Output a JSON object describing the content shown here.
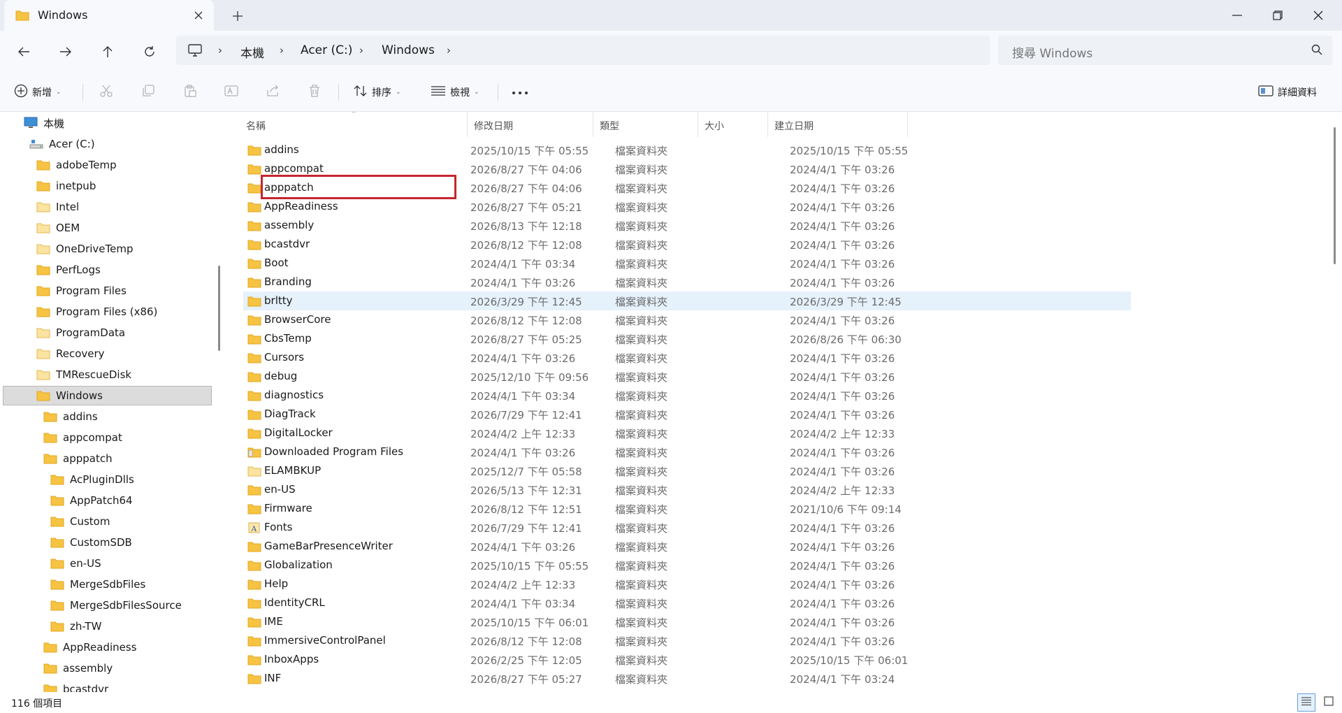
{
  "tab": {
    "title": "Windows"
  },
  "address": {
    "breadcrumbs": [
      "本機",
      "Acer (C:)",
      "Windows"
    ]
  },
  "search": {
    "placeholder": "搜尋 Windows"
  },
  "commands": {
    "new_label": "新增",
    "sort_label": "排序",
    "view_label": "檢視",
    "details_label": "詳細資料"
  },
  "columns": {
    "name": "名稱",
    "modified": "修改日期",
    "type": "類型",
    "size": "大小",
    "created": "建立日期"
  },
  "tree": [
    {
      "label": "本機",
      "level": 0,
      "icon": "computer-icon"
    },
    {
      "label": "Acer (C:)",
      "level": 1,
      "icon": "drive-icon"
    },
    {
      "label": "adobeTemp",
      "level": 2,
      "icon": "folder-icon"
    },
    {
      "label": "inetpub",
      "level": 2,
      "icon": "folder-icon"
    },
    {
      "label": "Intel",
      "level": 2,
      "icon": "folder-open-icon"
    },
    {
      "label": "OEM",
      "level": 2,
      "icon": "folder-open-icon"
    },
    {
      "label": "OneDriveTemp",
      "level": 2,
      "icon": "folder-open-icon"
    },
    {
      "label": "PerfLogs",
      "level": 2,
      "icon": "folder-icon"
    },
    {
      "label": "Program Files",
      "level": 2,
      "icon": "folder-icon"
    },
    {
      "label": "Program Files (x86)",
      "level": 2,
      "icon": "folder-icon"
    },
    {
      "label": "ProgramData",
      "level": 2,
      "icon": "folder-open-icon"
    },
    {
      "label": "Recovery",
      "level": 2,
      "icon": "folder-open-icon"
    },
    {
      "label": "TMRescueDisk",
      "level": 2,
      "icon": "folder-open-icon"
    },
    {
      "label": "Windows",
      "level": 2,
      "icon": "folder-icon",
      "selected": true
    },
    {
      "label": "addins",
      "level": 3,
      "icon": "folder-icon"
    },
    {
      "label": "appcompat",
      "level": 3,
      "icon": "folder-icon"
    },
    {
      "label": "apppatch",
      "level": 3,
      "icon": "folder-icon"
    },
    {
      "label": "AcPluginDlls",
      "level": 4,
      "icon": "folder-icon"
    },
    {
      "label": "AppPatch64",
      "level": 4,
      "icon": "folder-icon"
    },
    {
      "label": "Custom",
      "level": 4,
      "icon": "folder-icon"
    },
    {
      "label": "CustomSDB",
      "level": 4,
      "icon": "folder-icon"
    },
    {
      "label": "en-US",
      "level": 4,
      "icon": "folder-icon"
    },
    {
      "label": "MergeSdbFiles",
      "level": 4,
      "icon": "folder-icon"
    },
    {
      "label": "MergeSdbFilesSource",
      "level": 4,
      "icon": "folder-icon"
    },
    {
      "label": "zh-TW",
      "level": 4,
      "icon": "folder-icon"
    },
    {
      "label": "AppReadiness",
      "level": 3,
      "icon": "folder-icon"
    },
    {
      "label": "assembly",
      "level": 3,
      "icon": "folder-icon"
    },
    {
      "label": "bcastdvr",
      "level": 3,
      "icon": "folder-icon"
    }
  ],
  "files": [
    {
      "name": "addins",
      "modified": "2025/10/15 下午 05:55",
      "type": "檔案資料夾",
      "created": "2025/10/15 下午 05:55",
      "icon": "folder-icon"
    },
    {
      "name": "appcompat",
      "modified": "2026/8/27 下午 04:06",
      "type": "檔案資料夾",
      "created": "2024/4/1 下午 03:26",
      "icon": "folder-icon"
    },
    {
      "name": "apppatch",
      "modified": "2026/8/27 下午 04:06",
      "type": "檔案資料夾",
      "created": "2024/4/1 下午 03:26",
      "icon": "folder-icon"
    },
    {
      "name": "AppReadiness",
      "modified": "2026/8/27 下午 05:21",
      "type": "檔案資料夾",
      "created": "2024/4/1 下午 03:26",
      "icon": "folder-icon"
    },
    {
      "name": "assembly",
      "modified": "2026/8/13 下午 12:18",
      "type": "檔案資料夾",
      "created": "2024/4/1 下午 03:26",
      "icon": "folder-icon"
    },
    {
      "name": "bcastdvr",
      "modified": "2026/8/12 下午 12:08",
      "type": "檔案資料夾",
      "created": "2024/4/1 下午 03:26",
      "icon": "folder-icon"
    },
    {
      "name": "Boot",
      "modified": "2024/4/1 下午 03:34",
      "type": "檔案資料夾",
      "created": "2024/4/1 下午 03:26",
      "icon": "folder-icon"
    },
    {
      "name": "Branding",
      "modified": "2024/4/1 下午 03:26",
      "type": "檔案資料夾",
      "created": "2024/4/1 下午 03:26",
      "icon": "folder-icon"
    },
    {
      "name": "brltty",
      "modified": "2026/3/29 下午 12:45",
      "type": "檔案資料夾",
      "created": "2026/3/29 下午 12:45",
      "icon": "folder-icon",
      "hover": true
    },
    {
      "name": "BrowserCore",
      "modified": "2026/8/12 下午 12:08",
      "type": "檔案資料夾",
      "created": "2024/4/1 下午 03:26",
      "icon": "folder-icon"
    },
    {
      "name": "CbsTemp",
      "modified": "2026/8/27 下午 05:25",
      "type": "檔案資料夾",
      "created": "2026/8/26 下午 06:30",
      "icon": "folder-icon"
    },
    {
      "name": "Cursors",
      "modified": "2024/4/1 下午 03:26",
      "type": "檔案資料夾",
      "created": "2024/4/1 下午 03:26",
      "icon": "folder-icon"
    },
    {
      "name": "debug",
      "modified": "2025/12/10 下午 09:56",
      "type": "檔案資料夾",
      "created": "2024/4/1 下午 03:26",
      "icon": "folder-icon"
    },
    {
      "name": "diagnostics",
      "modified": "2024/4/1 下午 03:34",
      "type": "檔案資料夾",
      "created": "2024/4/1 下午 03:26",
      "icon": "folder-icon"
    },
    {
      "name": "DiagTrack",
      "modified": "2026/7/29 下午 12:41",
      "type": "檔案資料夾",
      "created": "2024/4/1 下午 03:26",
      "icon": "folder-icon"
    },
    {
      "name": "DigitalLocker",
      "modified": "2024/4/2 上午 12:33",
      "type": "檔案資料夾",
      "created": "2024/4/2 上午 12:33",
      "icon": "folder-icon"
    },
    {
      "name": "Downloaded Program Files",
      "modified": "2024/4/1 下午 03:26",
      "type": "檔案資料夾",
      "created": "2024/4/1 下午 03:26",
      "icon": "folder-special-icon"
    },
    {
      "name": "ELAMBKUP",
      "modified": "2025/12/7 下午 05:58",
      "type": "檔案資料夾",
      "created": "2024/4/1 下午 03:26",
      "icon": "folder-open-icon"
    },
    {
      "name": "en-US",
      "modified": "2026/5/13 下午 12:31",
      "type": "檔案資料夾",
      "created": "2024/4/2 上午 12:33",
      "icon": "folder-icon"
    },
    {
      "name": "Firmware",
      "modified": "2026/8/12 下午 12:51",
      "type": "檔案資料夾",
      "created": "2021/10/6 下午 09:14",
      "icon": "folder-icon"
    },
    {
      "name": "Fonts",
      "modified": "2026/7/29 下午 12:41",
      "type": "檔案資料夾",
      "created": "2024/4/1 下午 03:26",
      "icon": "fonts-folder-icon"
    },
    {
      "name": "GameBarPresenceWriter",
      "modified": "2024/4/1 下午 03:26",
      "type": "檔案資料夾",
      "created": "2024/4/1 下午 03:26",
      "icon": "folder-icon"
    },
    {
      "name": "Globalization",
      "modified": "2025/10/15 下午 05:55",
      "type": "檔案資料夾",
      "created": "2024/4/1 下午 03:26",
      "icon": "folder-icon"
    },
    {
      "name": "Help",
      "modified": "2024/4/2 上午 12:33",
      "type": "檔案資料夾",
      "created": "2024/4/1 下午 03:26",
      "icon": "folder-icon"
    },
    {
      "name": "IdentityCRL",
      "modified": "2024/4/1 下午 03:34",
      "type": "檔案資料夾",
      "created": "2024/4/1 下午 03:26",
      "icon": "folder-icon"
    },
    {
      "name": "IME",
      "modified": "2025/10/15 下午 06:01",
      "type": "檔案資料夾",
      "created": "2024/4/1 下午 03:26",
      "icon": "folder-icon"
    },
    {
      "name": "ImmersiveControlPanel",
      "modified": "2026/8/12 下午 12:08",
      "type": "檔案資料夾",
      "created": "2024/4/1 下午 03:26",
      "icon": "folder-icon"
    },
    {
      "name": "InboxApps",
      "modified": "2026/2/25 下午 12:05",
      "type": "檔案資料夾",
      "created": "2025/10/15 下午 06:01",
      "icon": "folder-icon"
    },
    {
      "name": "INF",
      "modified": "2026/8/27 下午 05:27",
      "type": "檔案資料夾",
      "created": "2024/4/1 下午 03:24",
      "icon": "folder-icon"
    }
  ],
  "status": {
    "item_count": "116 個項目"
  },
  "colors": {
    "folder": "#f6c343",
    "folder_dark": "#e3a71c",
    "accent": "#005fb8",
    "highlight_box": "#c4262e",
    "hover_row": "#e5f1fb",
    "selected_tree": "#dcdcdc"
  }
}
